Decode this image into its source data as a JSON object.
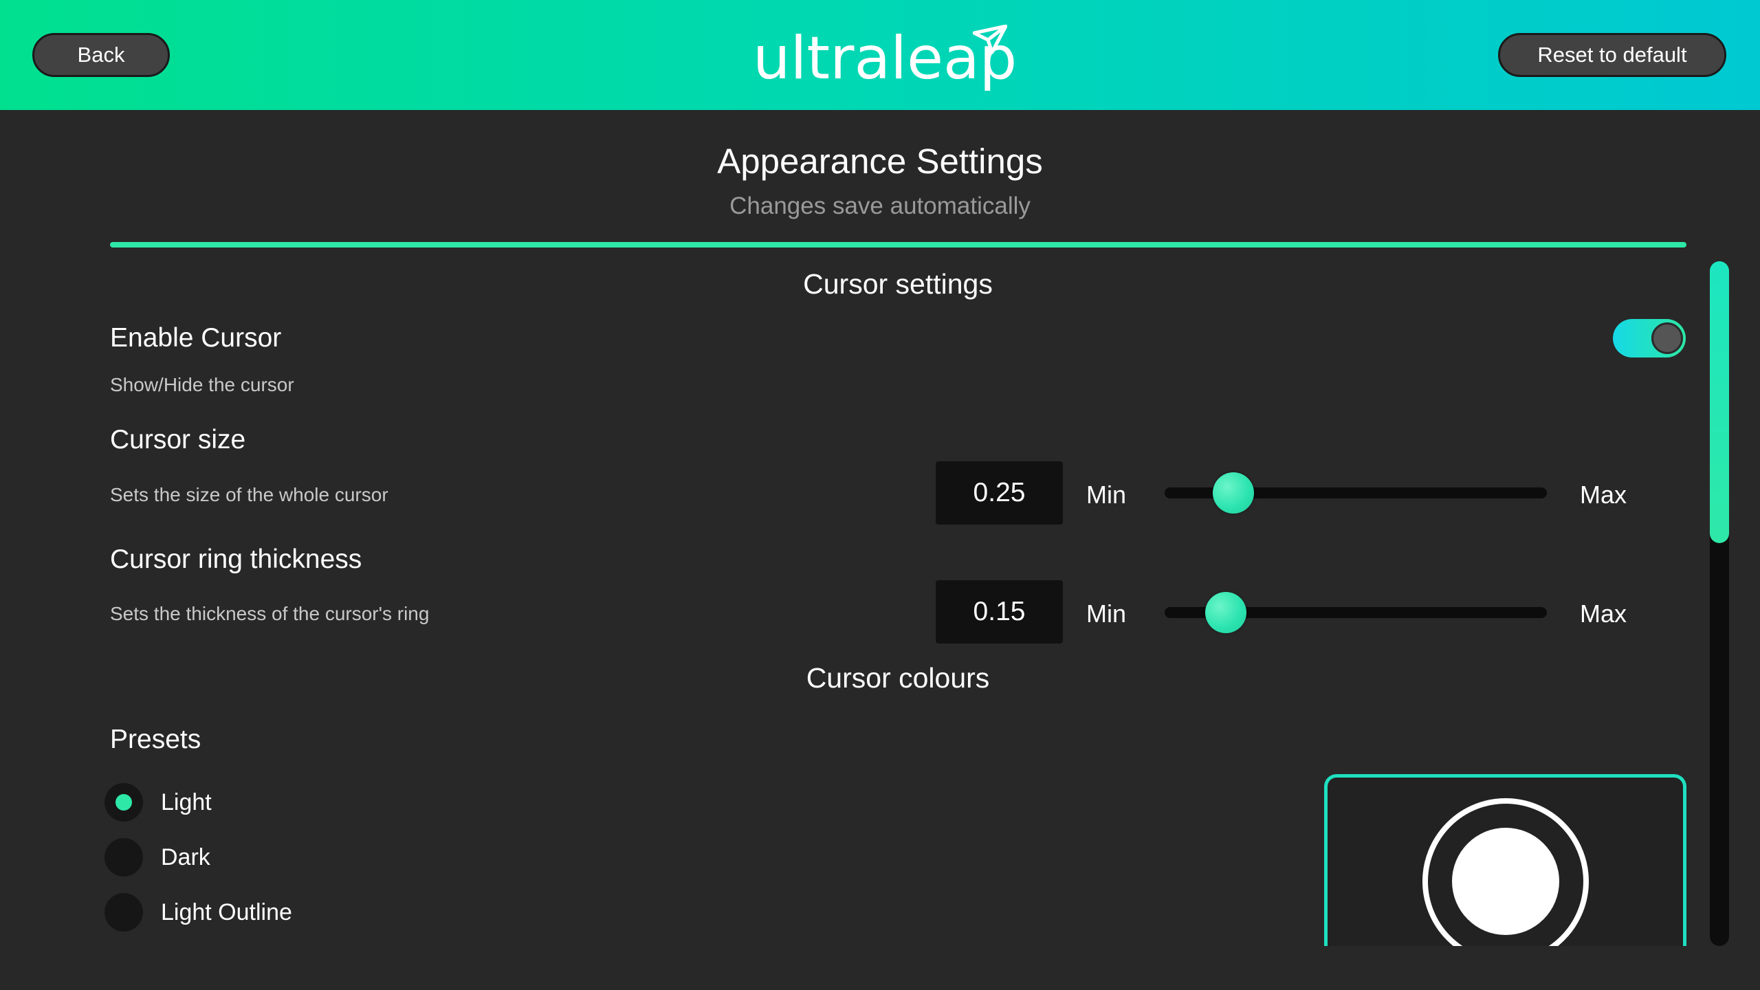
{
  "header": {
    "back_label": "Back",
    "reset_label": "Reset to default",
    "logo_text": "ultraleap"
  },
  "page": {
    "title": "Appearance Settings",
    "subtitle": "Changes save automatically"
  },
  "cursor_settings": {
    "section_title": "Cursor settings",
    "enable_cursor": {
      "label": "Enable Cursor",
      "description": "Show/Hide the cursor",
      "enabled": true
    },
    "cursor_size": {
      "label": "Cursor size",
      "description": "Sets the size of the whole cursor",
      "value": "0.25",
      "min_label": "Min",
      "max_label": "Max",
      "slider_fraction": 0.18
    },
    "ring_thickness": {
      "label": "Cursor ring thickness",
      "description": "Sets the thickness of the cursor's ring",
      "value": "0.15",
      "min_label": "Min",
      "max_label": "Max",
      "slider_fraction": 0.16
    }
  },
  "cursor_colours": {
    "section_title": "Cursor colours",
    "presets_label": "Presets",
    "presets": [
      {
        "label": "Light",
        "selected": true
      },
      {
        "label": "Dark",
        "selected": false
      },
      {
        "label": "Light Outline",
        "selected": false
      }
    ]
  },
  "colors": {
    "accent": "#2ee8a8",
    "header_gradient_start": "#00e08f",
    "header_gradient_end": "#00c9d2",
    "background": "#282828"
  },
  "scroll": {
    "position_fraction": 0.0
  }
}
